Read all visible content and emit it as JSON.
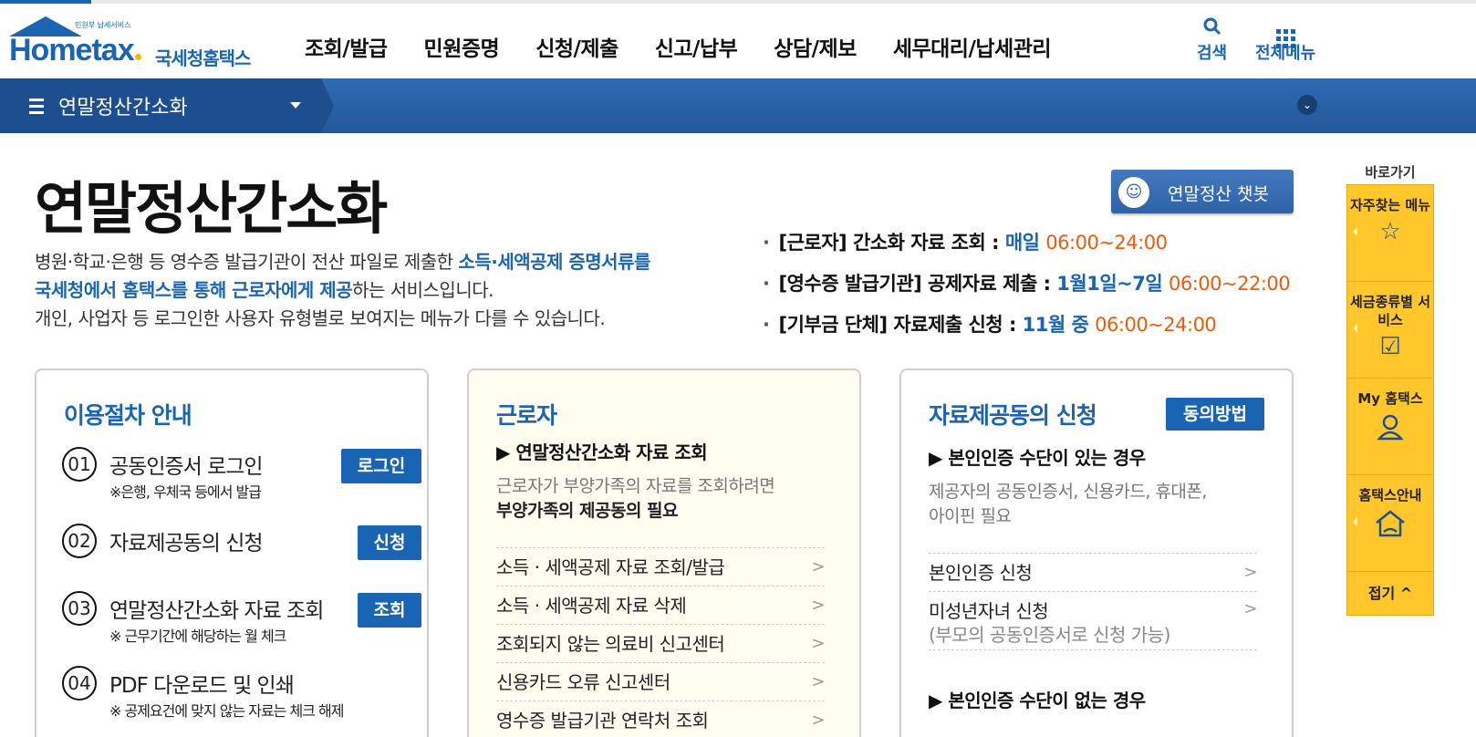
{
  "header": {
    "logo_small": "민원부 납세서비스",
    "logo_brand": "Hometax",
    "logo_kr": "국세청홈택스",
    "gnb": [
      "조회/발급",
      "민원증명",
      "신청/제출",
      "신고/납부",
      "상담/제보",
      "세무대리/납세관리"
    ],
    "search_label": "검색",
    "menu_label": "전체메뉴"
  },
  "subnav": {
    "title": "연말정산간소화"
  },
  "page": {
    "title": "연말정산간소화",
    "desc_1a": "병원·학교·은행 등 영수증 발급기관이 전산 파일로 제출한 ",
    "desc_1b": "소득·세액공제 증명서류를",
    "desc_2a": "국세청에서 홈택스를 통해 근로자에게 제공",
    "desc_2b": "하는 서비스입니다.",
    "desc_3": "개인, 사업자 등 로그인한 사용자 유형별로 보여지는 메뉴가 다를 수 있습니다."
  },
  "chatbot": {
    "label": "연말정산 챗봇"
  },
  "schedule": [
    {
      "label": "[근로자] 간소화 자료 조회 : ",
      "period": "매일 ",
      "time": "06:00~24:00"
    },
    {
      "label": "[영수증 발급기관] 공제자료 제출 : ",
      "period": "1월1일~7일 ",
      "time": "06:00~22:00"
    },
    {
      "label": "[기부금 단체] 자료제출 신청 : ",
      "period": "11월 중 ",
      "time": "06:00~24:00"
    }
  ],
  "card_guide": {
    "title": "이용절차 안내",
    "steps": [
      {
        "num": "01",
        "title": "공동인증서 로그인",
        "sub": "※은행, 우체국 등에서 발급",
        "button": "로그인"
      },
      {
        "num": "02",
        "title": "자료제공동의 신청",
        "sub": "",
        "button": "신청"
      },
      {
        "num": "03",
        "title": "연말정산간소화 자료 조회",
        "sub": "※ 근무기간에 해당하는 월 체크",
        "button": "조회"
      },
      {
        "num": "04",
        "title": "PDF 다운로드 및 인쇄",
        "sub": "※ 공제요건에 맞지 않는 자료는 체크 해제",
        "button": ""
      }
    ]
  },
  "card_worker": {
    "title": "근로자",
    "sub_heading": "▶ 연말정산간소화 자료 조회",
    "note_1": "근로자가 부양가족의 자료를 조회하려면",
    "note_2": "부양가족의 제공동의 필요",
    "links": [
      "소득 · 세액공제 자료 조회/발급",
      "소득 · 세액공제 자료 삭제",
      "조회되지 않는 의료비 신고센터",
      "신용카드 오류 신고센터",
      "영수증 발급기관 연락처 조회"
    ]
  },
  "card_consent": {
    "title": "자료제공동의 신청",
    "button": "동의방법",
    "sub_heading_1": "▶ 본인인증 수단이 있는 경우",
    "note_1": "제공자의 공동인증서, 신용카드, 휴대폰,",
    "note_2": "아이핀 필요",
    "link_1": "본인인증 신청",
    "link_2a": "미성년자녀 신청",
    "link_2b": "(부모의 공동인증서로 신청 가능)",
    "sub_heading_2": "▶ 본인인증 수단이 없는 경우"
  },
  "quick": {
    "heading": "바로가기",
    "items": [
      {
        "label": "자주찾는 메뉴",
        "icon": "star-icon"
      },
      {
        "label": "세금종류별 서비스",
        "icon": "checkbox-icon"
      },
      {
        "label": "My 홈택스",
        "icon": "user-icon"
      },
      {
        "label": "홈택스안내",
        "icon": "home-icon"
      }
    ],
    "fold": "접기 ^"
  },
  "colors": {
    "brand_blue": "#1a64b4",
    "orange": "#f05a0a",
    "quick_yellow": "#ffc72c"
  }
}
